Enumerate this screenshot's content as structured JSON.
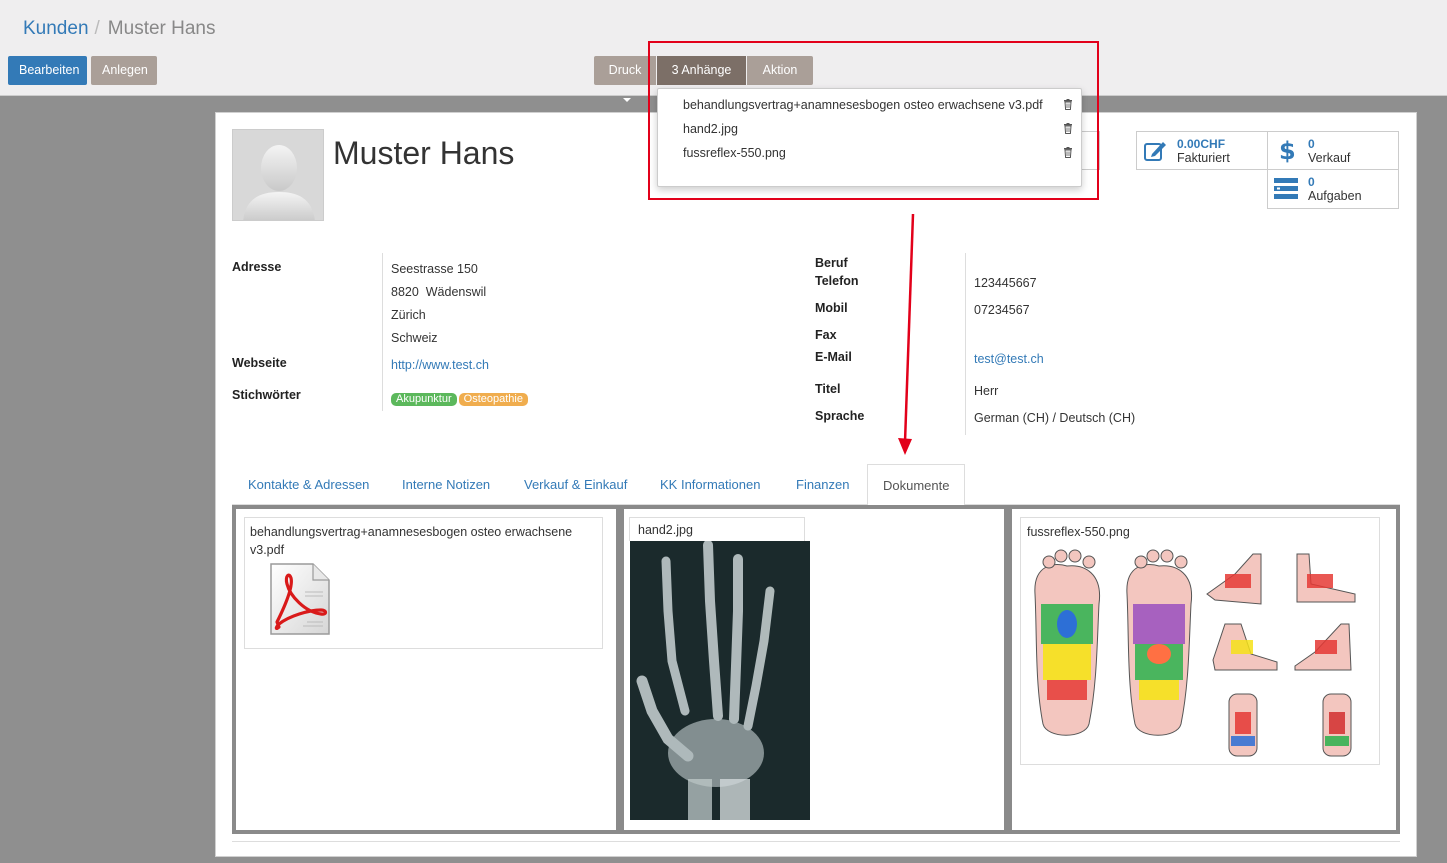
{
  "breadcrumb": {
    "parent": "Kunden",
    "separator": "/",
    "current": "Muster Hans"
  },
  "buttons": {
    "edit": "Bearbeiten",
    "create": "Anlegen",
    "print": "Druck",
    "attachments": "3 Anhänge",
    "action": "Aktion"
  },
  "attachments_dropdown": [
    {
      "name": "behandlungsvertrag+anamnesesbogen osteo erwachsene v3.pdf"
    },
    {
      "name": "hand2.jpg"
    },
    {
      "name": "fussreflex-550.png"
    }
  ],
  "record": {
    "name": "Muster Hans"
  },
  "stats": {
    "invoiced": {
      "value": "0.00CHF",
      "label": "Fakturiert"
    },
    "sales": {
      "value": "0",
      "label": "Verkauf"
    },
    "tasks": {
      "value": "0",
      "label": "Aufgaben"
    }
  },
  "left_fields": {
    "address_label": "Adresse",
    "street": "Seestrasse 150",
    "zip_city": "8820  Wädenswil",
    "state": "Zürich",
    "country": "Schweiz",
    "website_label": "Webseite",
    "website": "http://www.test.ch",
    "tags_label": "Stichwörter",
    "tags": [
      {
        "name": "Akupunktur",
        "color": "#5cb85c"
      },
      {
        "name": "Osteopathie",
        "color": "#f0ad4e"
      }
    ]
  },
  "right_fields": {
    "job_label": "Beruf",
    "phone_label": "Telefon",
    "phone": "123445667",
    "mobile_label": "Mobil",
    "mobile": "07234567",
    "fax_label": "Fax",
    "email_label": "E-Mail",
    "email": "test@test.ch",
    "title_label": "Titel",
    "title": "Herr",
    "language_label": "Sprache",
    "language": "German (CH) / Deutsch (CH)"
  },
  "tabs": [
    {
      "label": "Kontakte & Adressen"
    },
    {
      "label": "Interne Notizen"
    },
    {
      "label": "Verkauf & Einkauf"
    },
    {
      "label": "KK Informationen"
    },
    {
      "label": "Finanzen"
    },
    {
      "label": "Dokumente",
      "active": true
    }
  ],
  "documents": [
    {
      "name": "behandlungsvertrag+anamnesesbogen osteo erwachsene v3.pdf"
    },
    {
      "name": "hand2.jpg"
    },
    {
      "name": "fussreflex-550.png"
    }
  ],
  "colors": {
    "primary": "#337ab7",
    "highlight": "#e2001a",
    "button_grey": "#aa9f98",
    "button_active": "#7c6f67"
  }
}
